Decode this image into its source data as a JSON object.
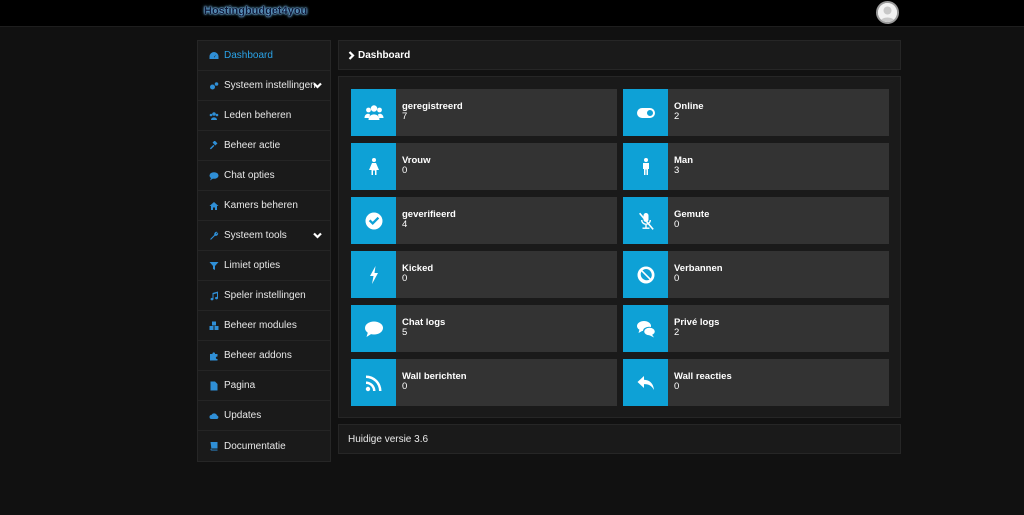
{
  "app": {
    "brand": "Hostingbudget4you"
  },
  "colors": {
    "accent": "#0ea1d6",
    "sidebar_icon": "#2f8fd6",
    "active_text": "#2aa3e8",
    "card_bg": "#333333",
    "panel_bg": "#1a1a1a",
    "page_bg": "#111111"
  },
  "sidebar": {
    "items": [
      {
        "label": "Dashboard",
        "icon": "dashboard-icon",
        "active": true,
        "expandable": false
      },
      {
        "label": "Systeem instellingen",
        "icon": "cogs-icon",
        "active": false,
        "expandable": true
      },
      {
        "label": "Leden beheren",
        "icon": "users-icon",
        "active": false,
        "expandable": false
      },
      {
        "label": "Beheer actie",
        "icon": "gavel-icon",
        "active": false,
        "expandable": false
      },
      {
        "label": "Chat opties",
        "icon": "comment-icon",
        "active": false,
        "expandable": false
      },
      {
        "label": "Kamers beheren",
        "icon": "home-icon",
        "active": false,
        "expandable": false
      },
      {
        "label": "Systeem tools",
        "icon": "wrench-icon",
        "active": false,
        "expandable": true
      },
      {
        "label": "Limiet opties",
        "icon": "filter-icon",
        "active": false,
        "expandable": false
      },
      {
        "label": "Speler instellingen",
        "icon": "music-icon",
        "active": false,
        "expandable": false
      },
      {
        "label": "Beheer modules",
        "icon": "cubes-icon",
        "active": false,
        "expandable": false
      },
      {
        "label": "Beheer addons",
        "icon": "puzzle-icon",
        "active": false,
        "expandable": false
      },
      {
        "label": "Pagina",
        "icon": "file-icon",
        "active": false,
        "expandable": false
      },
      {
        "label": "Updates",
        "icon": "cloud-download-icon",
        "active": false,
        "expandable": false
      },
      {
        "label": "Documentatie",
        "icon": "book-icon",
        "active": false,
        "expandable": false
      }
    ]
  },
  "breadcrumb": {
    "label": "Dashboard"
  },
  "stats": [
    {
      "title": "geregistreerd",
      "count": "7",
      "icon": "users-icon"
    },
    {
      "title": "Online",
      "count": "2",
      "icon": "toggle-on-icon"
    },
    {
      "title": "Vrouw",
      "count": "0",
      "icon": "female-icon"
    },
    {
      "title": "Man",
      "count": "3",
      "icon": "male-icon"
    },
    {
      "title": "geverifieerd",
      "count": "4",
      "icon": "check-circle-icon"
    },
    {
      "title": "Gemute",
      "count": "0",
      "icon": "microphone-slash-icon"
    },
    {
      "title": "Kicked",
      "count": "0",
      "icon": "bolt-icon"
    },
    {
      "title": "Verbannen",
      "count": "0",
      "icon": "ban-icon"
    },
    {
      "title": "Chat logs",
      "count": "5",
      "icon": "comment-icon"
    },
    {
      "title": "Privé logs",
      "count": "2",
      "icon": "comments-icon"
    },
    {
      "title": "Wall berichten",
      "count": "0",
      "icon": "rss-icon"
    },
    {
      "title": "Wall reacties",
      "count": "0",
      "icon": "reply-icon"
    }
  ],
  "footer": {
    "version_text": "Huidige versie 3.6"
  }
}
